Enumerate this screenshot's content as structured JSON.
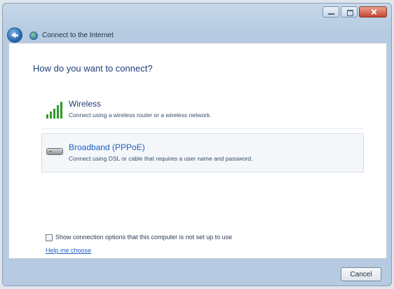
{
  "window": {
    "title": "Connect to the Internet",
    "controls": {
      "minimize": "minimize",
      "maximize": "maximize",
      "close": "close"
    }
  },
  "content": {
    "heading": "How do you want to connect?",
    "options": [
      {
        "title": "Wireless",
        "description": "Connect using a wireless router or a wireless network.",
        "icon": "wireless-signal-icon"
      },
      {
        "title": "Broadband (PPPoE)",
        "description": "Connect using DSL or cable that requires a user name and password.",
        "icon": "modem-icon"
      }
    ],
    "show_options_label": "Show connection options that this computer is not set up to use",
    "help_link": "Help me choose"
  },
  "footer": {
    "cancel_label": "Cancel"
  },
  "colors": {
    "accent_blue": "#1f5fbf",
    "heading_blue": "#1f3d7a",
    "signal_green": "#2f9a2a"
  }
}
